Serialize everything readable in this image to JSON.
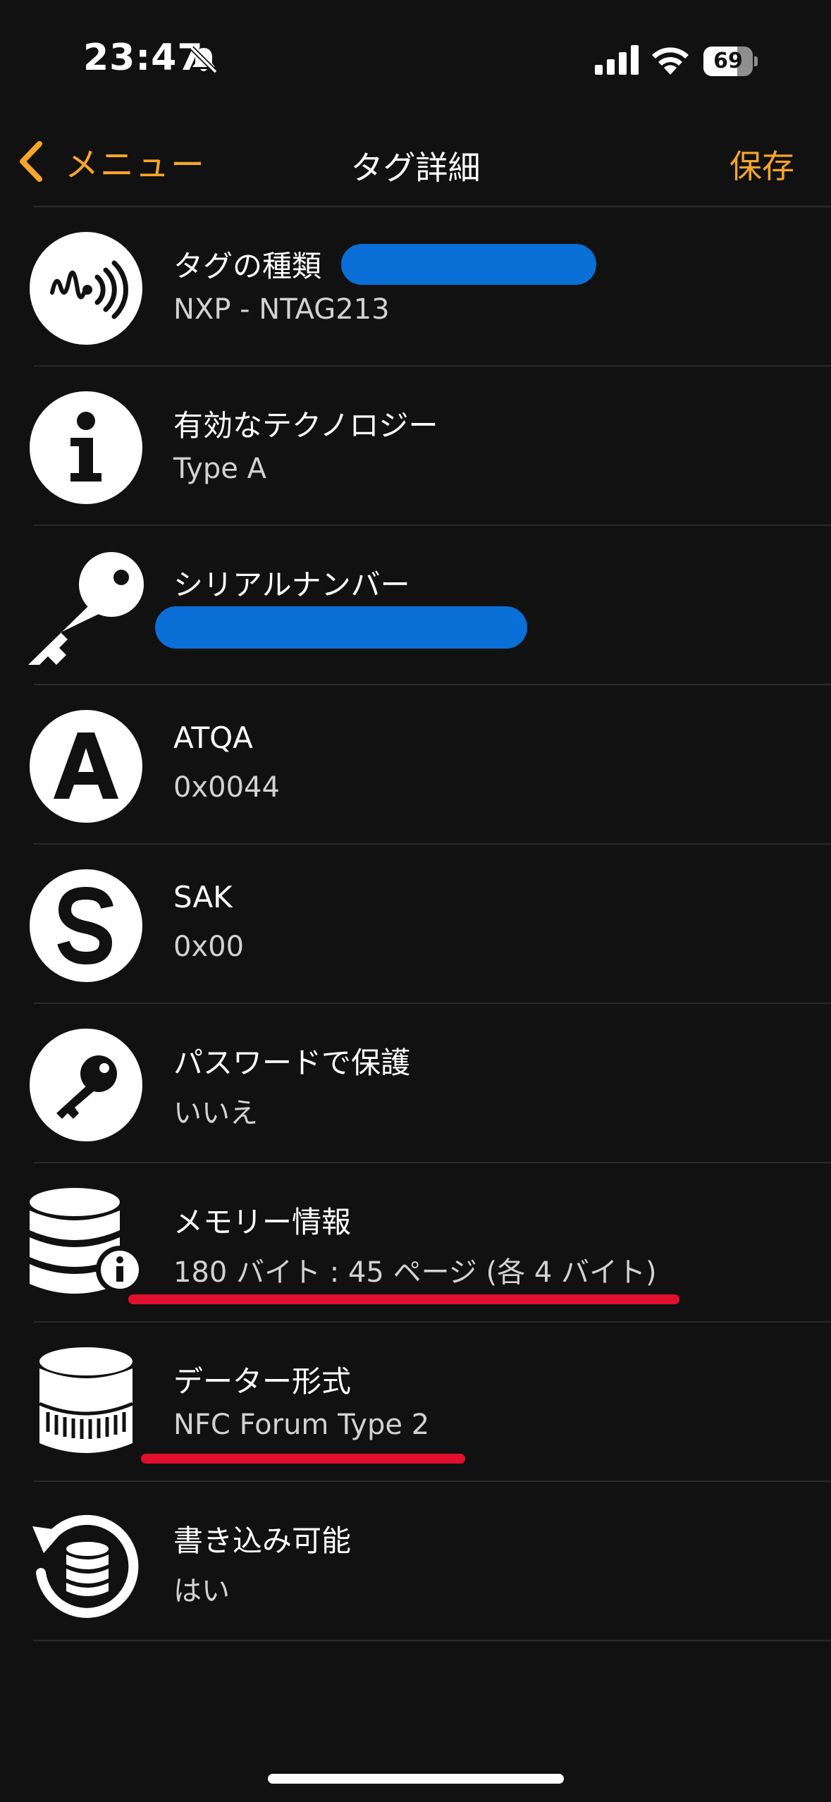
{
  "status_bar": {
    "time": "23:47",
    "battery_level": "69",
    "battery_fraction": 0.69,
    "icons": [
      "bell-slash-icon",
      "cellular-signal-icon",
      "wifi-icon",
      "battery-icon"
    ]
  },
  "nav": {
    "back_label": "メニュー",
    "title": "タグ詳細",
    "save_label": "保存",
    "accent_color": "#f7a52a"
  },
  "rows": [
    {
      "icon": "nfc-signal-icon",
      "title": "タグの種類",
      "value": "NXP - NTAG213"
    },
    {
      "icon": "info-icon",
      "title": "有効なテクノロジー",
      "value": "Type A"
    },
    {
      "icon": "key-icon",
      "title": "シリアルナンバー",
      "value": ""
    },
    {
      "icon": "letter-a-icon",
      "title": "ATQA",
      "value": "0x0044"
    },
    {
      "icon": "letter-s-icon",
      "title": "SAK",
      "value": "0x00"
    },
    {
      "icon": "key-lock-icon",
      "title": "パスワードで保護",
      "value": "いいえ"
    },
    {
      "icon": "database-info-icon",
      "title": "メモリー情報",
      "value": "180 バイト : 45 ページ (各 4 バイト)"
    },
    {
      "icon": "database-icon",
      "title": "データー形式",
      "value": "NFC Forum Type 2"
    },
    {
      "icon": "database-sync-icon",
      "title": "書き込み可能",
      "value": "はい"
    }
  ],
  "colors": {
    "background": "#111111",
    "divider": "#2a2a2a",
    "redaction": "#0a6fd6",
    "annotation_underline": "#e0102c"
  }
}
